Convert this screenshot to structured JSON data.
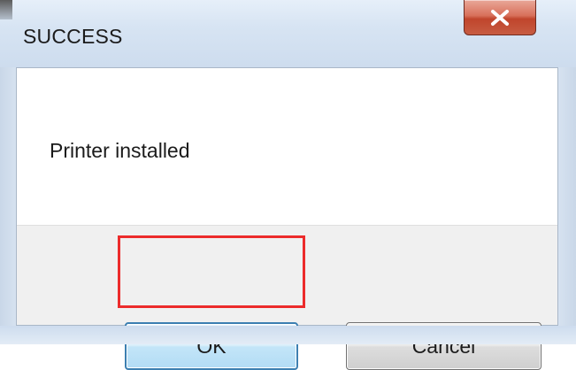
{
  "window": {
    "title": "SUCCESS",
    "close_icon": "close-icon"
  },
  "dialog": {
    "message": "Printer installed"
  },
  "buttons": {
    "ok_label": "OK",
    "cancel_label": "Cancel"
  },
  "colors": {
    "highlight": "#ec2b2b",
    "close_button": "#c0452c",
    "ok_border": "#3c7fb1"
  }
}
